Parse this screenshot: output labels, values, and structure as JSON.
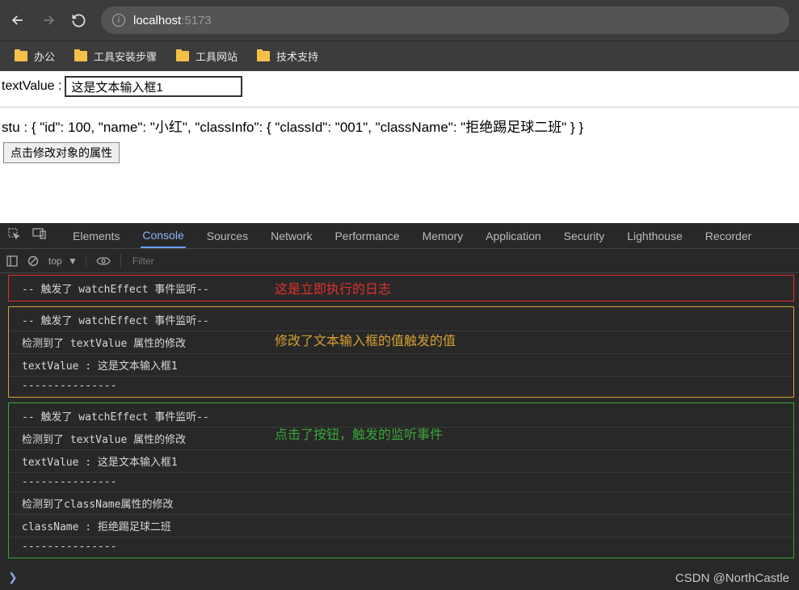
{
  "browser": {
    "url_host": "localhost",
    "url_port": ":5173"
  },
  "bookmarks": [
    {
      "label": "办公"
    },
    {
      "label": "工具安装步骤"
    },
    {
      "label": "工具网站"
    },
    {
      "label": "技术支持"
    }
  ],
  "page": {
    "text_label": "textValue : ",
    "text_value": "这是文本输入框1",
    "stu_line": "stu : { \"id\": 100, \"name\": \"小红\", \"classInfo\": { \"classId\": \"001\", \"className\": \"拒绝踢足球二班\" } }",
    "button_label": "点击修改对象的属性"
  },
  "devtools": {
    "tabs": [
      "Elements",
      "Console",
      "Sources",
      "Network",
      "Performance",
      "Memory",
      "Application",
      "Security",
      "Lighthouse",
      "Recorder"
    ],
    "active_tab": "Console",
    "context": "top",
    "filter_placeholder": "Filter"
  },
  "console": {
    "group1": {
      "annotation": "这是立即执行的日志",
      "lines": [
        "-- 触发了 watchEffect 事件监听--"
      ]
    },
    "group2": {
      "annotation": "修改了文本输入框的值触发的值",
      "lines": [
        "-- 触发了 watchEffect 事件监听--",
        "检测到了 textValue 属性的修改",
        "textValue :  这是文本输入框1",
        "---------------"
      ]
    },
    "group3": {
      "annotation": "点击了按钮，触发的监听事件",
      "lines": [
        "-- 触发了 watchEffect 事件监听--",
        "检测到了 textValue 属性的修改",
        "textValue :  这是文本输入框1",
        "---------------",
        "检测到了className属性的修改",
        "className :  拒绝踢足球二班",
        "---------------"
      ]
    }
  },
  "watermark": "CSDN @NorthCastle"
}
